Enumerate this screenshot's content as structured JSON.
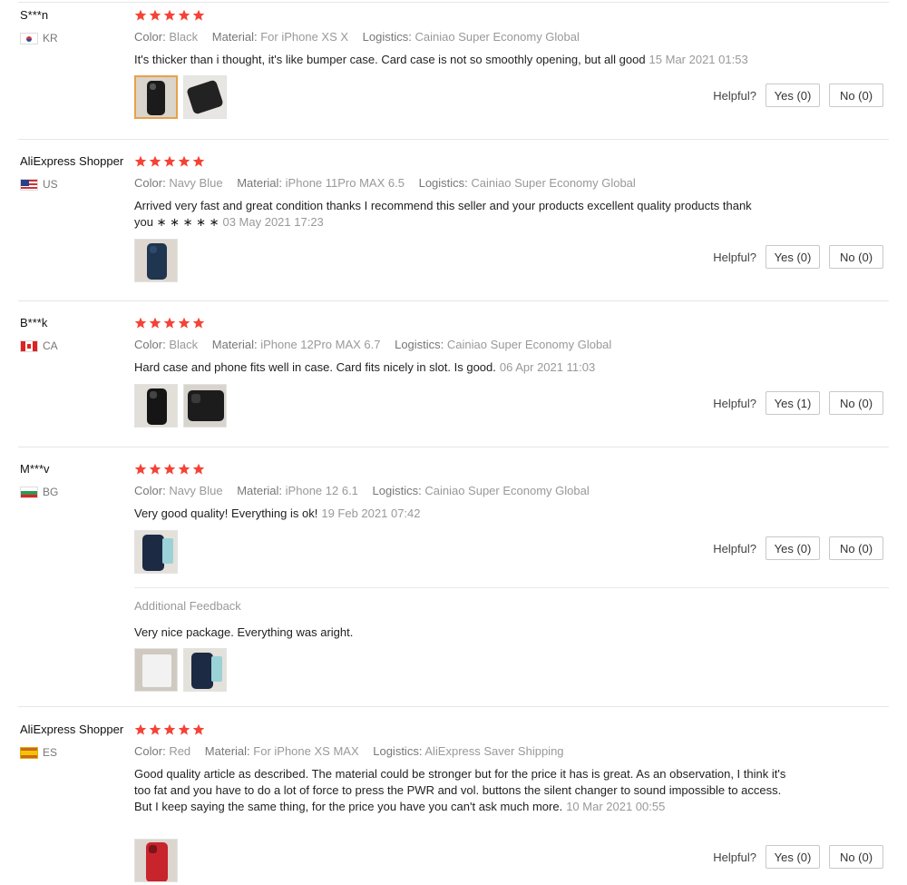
{
  "labels": {
    "color": "Color:",
    "material": "Material:",
    "logistics": "Logistics:",
    "helpful": "Helpful?",
    "additional_feedback": "Additional Feedback"
  },
  "colors": {
    "star": "#f44336",
    "selected_thumb_border": "#e9a04a",
    "divider": "#e6e6e6"
  },
  "reviews": [
    {
      "user": "S***n",
      "country": "KR",
      "rating": 5,
      "color": "Black",
      "material": "For iPhone XS X",
      "logistics": "Cainiao Super Economy Global",
      "text": "It's thicker than i thought, it's like bumper case. Card case is not so smoothly opening, but all good",
      "date": "15 Mar 2021 01:53",
      "yes": "Yes (0)",
      "no": "No (0)"
    },
    {
      "user": "AliExpress Shopper",
      "country": "US",
      "rating": 5,
      "color": "Navy Blue",
      "material": "iPhone 11Pro MAX 6.5",
      "logistics": "Cainiao Super Economy Global",
      "text": "Arrived very fast and great condition thanks I recommend this seller and your products excellent quality products thank you ∗ ∗ ∗ ∗ ∗",
      "date": "03 May 2021 17:23",
      "yes": "Yes (0)",
      "no": "No (0)"
    },
    {
      "user": "B***k",
      "country": "CA",
      "rating": 5,
      "color": "Black",
      "material": "iPhone 12Pro MAX 6.7",
      "logistics": "Cainiao Super Economy Global",
      "text": "Hard case and phone fits well in case. Card fits nicely in slot. Is good.",
      "date": "06 Apr 2021 11:03",
      "yes": "Yes (1)",
      "no": "No (0)"
    },
    {
      "user": "M***v",
      "country": "BG",
      "rating": 5,
      "color": "Navy Blue",
      "material": "iPhone 12 6.1",
      "logistics": "Cainiao Super Economy Global",
      "text": "Very good quality! Everything is ok!",
      "date": "19 Feb 2021 07:42",
      "yes": "Yes (0)",
      "no": "No (0)",
      "additional_text": "Very nice package. Everything was aright."
    },
    {
      "user": "AliExpress Shopper",
      "country": "ES",
      "rating": 5,
      "color": "Red",
      "material": "For iPhone XS MAX",
      "logistics": "AliExpress Saver Shipping",
      "text": "Good quality article as described. The material could be stronger but for the price it has is great. As an observation, I think it's too fat and you have to do a lot of force to press the PWR and vol. buttons the silent changer to sound impossible to access. But I keep saying the same thing, for the price you have you can't ask much more.",
      "date": "10 Mar 2021 00:55",
      "yes": "Yes (0)",
      "no": "No (0)"
    }
  ]
}
